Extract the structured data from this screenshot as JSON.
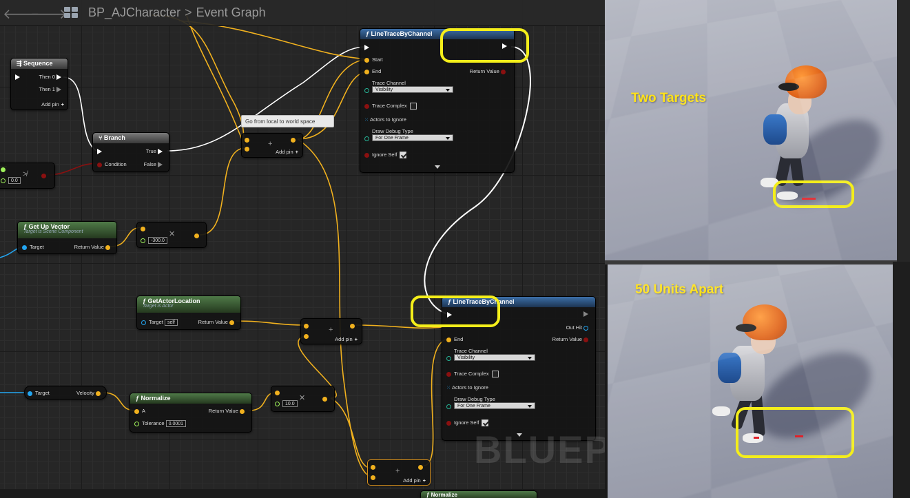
{
  "header": {
    "breadcrumb_root": "BP_AJCharacter",
    "breadcrumb_sep": ">",
    "breadcrumb_current": "Event Graph",
    "back_glyph": "🡐",
    "forward_glyph": "🡒"
  },
  "nodes": {
    "sequence": {
      "title": "Sequence",
      "then0": "Then 0",
      "then1": "Then 1",
      "add_pin": "Add pin"
    },
    "branch": {
      "title": "Branch",
      "true": "True",
      "false": "False",
      "condition": "Condition"
    },
    "literal": {
      "value": "0.0"
    },
    "up_vector": {
      "title": "Get Up Vector",
      "subtitle": "Target is Scene Component",
      "target": "Target",
      "return": "Return Value"
    },
    "multiply1": {
      "value": "-300.0"
    },
    "add1": {
      "add_pin": "Add pin"
    },
    "actor_location": {
      "title": "GetActorLocation",
      "subtitle": "Target is Actor",
      "target": "Target",
      "self": "self",
      "return": "Return Value"
    },
    "add2": {
      "add_pin": "Add pin"
    },
    "velocity": {
      "target": "Target",
      "velocity": "Velocity"
    },
    "normalize": {
      "title": "Normalize",
      "a": "A",
      "tolerance": "Tolerance",
      "tolerance_value": "0.0001",
      "return": "Return Value"
    },
    "multiply2": {
      "value": "10.0"
    },
    "add3": {
      "add_pin": "Add pin"
    },
    "trace1": {
      "title": "LineTraceByChannel",
      "start": "Start",
      "end": "End",
      "return": "Return Value",
      "trace_channel": "Trace Channel",
      "trace_channel_value": "Visibility",
      "trace_complex": "Trace Complex",
      "actors_to_ignore": "Actors to Ignore",
      "draw_debug": "Draw Debug Type",
      "draw_debug_value": "For One Frame",
      "ignore_self": "Ignore Self"
    },
    "trace2": {
      "title": "LineTraceByChannel",
      "out_hit": "Out Hit",
      "end": "End",
      "return": "Return Value",
      "trace_channel": "Trace Channel",
      "trace_channel_value": "Visibility",
      "trace_complex": "Trace Complex",
      "actors_to_ignore": "Actors to Ignore",
      "draw_debug": "Draw Debug Type",
      "draw_debug_value": "For One Frame",
      "ignore_self": "Ignore Self"
    },
    "bottom_normalize": {
      "title": "Normalize"
    }
  },
  "comment": {
    "text": "Go from local to world space"
  },
  "watermark": {
    "text": "BLUEPR"
  },
  "viewport": {
    "top_label": "Two Targets",
    "bottom_label": "50 Units Apart"
  },
  "colors": {
    "highlight": "#f4ee1a",
    "exec_wire": "#ffffff",
    "vector_wire": "#f1b11e",
    "bool_wire": "#8a1010",
    "object_wire": "#23a5f0",
    "label": "#ffe21a"
  }
}
